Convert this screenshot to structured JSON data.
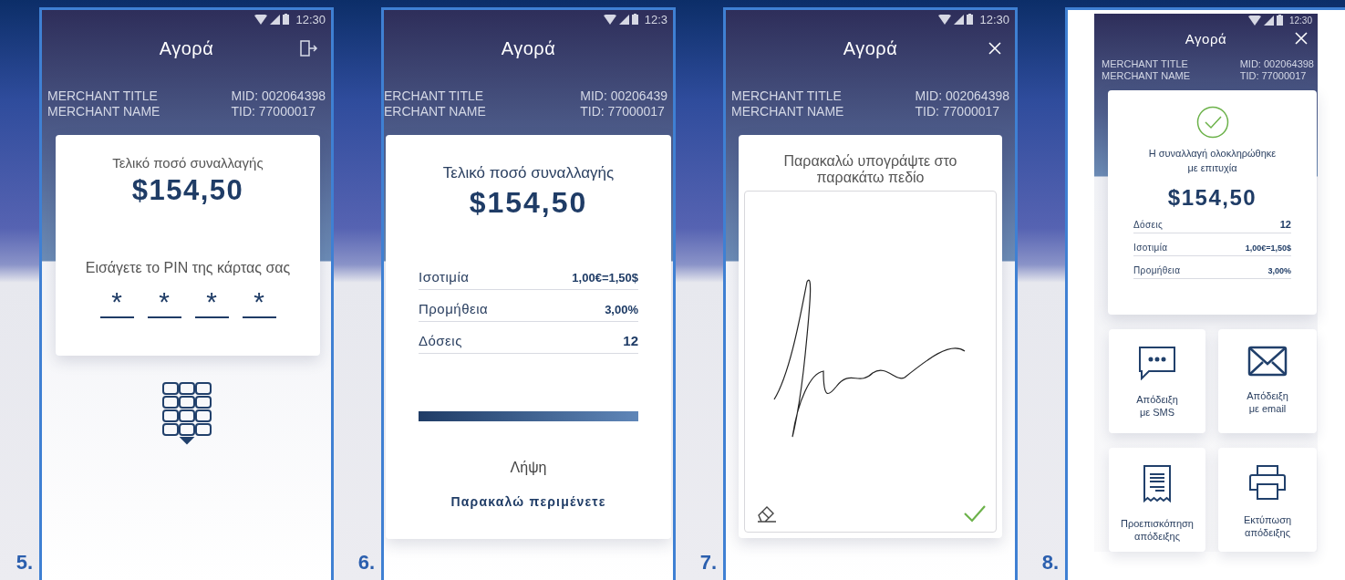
{
  "screens": [
    {
      "kind": "pin",
      "step": "5.",
      "status_time": "12:30",
      "title": "Αγορά",
      "merchant_title": "MERCHANT TITLE",
      "merchant_name": "MERCHANT NAME",
      "mid": "MID: 002064398",
      "tid": "TID: 77000017",
      "amount_label": "Τελικό ποσό συναλλαγής",
      "amount": "$154,50",
      "pin_prompt": "Εισάγετε το PIN της κάρτας σας",
      "pin_digits": [
        "*",
        "*",
        "*",
        "*"
      ]
    },
    {
      "kind": "processing",
      "step": "6.",
      "status_time": "12:3",
      "title": "Αγορά",
      "merchant_title": "ERCHANT TITLE",
      "merchant_name": "ERCHANT NAME",
      "mid": "MID: 00206439",
      "tid": "TID: 77000017",
      "amount_label": "Τελικό ποσό συναλλαγής",
      "amount": "$154,50",
      "details": [
        {
          "label": "Ισοτιμία",
          "value": "1,00€=1,50$"
        },
        {
          "label": "Προμήθεια",
          "value": "3,00%"
        },
        {
          "label": "Δόσεις",
          "value": "12"
        }
      ],
      "progress": {
        "level": 1
      },
      "status": "Λήψη",
      "message": "Παρακαλώ περιμένετε"
    },
    {
      "kind": "signature",
      "step": "7.",
      "status_time": "12:30",
      "title": "Αγορά",
      "merchant_title": "MERCHANT TITLE",
      "merchant_name": "MERCHANT NAME",
      "mid": "MID: 002064398",
      "tid": "TID: 77000017",
      "prompt": "Παρακαλώ υπογράψτε στο παρακάτω πεδίο"
    },
    {
      "kind": "receipt",
      "step": "8.",
      "status_time": "12:30",
      "title": "Αγορά",
      "merchant_title": "MERCHANT TITLE",
      "merchant_name": "MERCHANT NAME",
      "mid": "MID: 002064398",
      "tid": "TID: 77000017",
      "message": "Η συναλλαγή ολοκληρώθηκε με επιτυχία",
      "amount": "$154,50",
      "details": [
        {
          "label": "Δόσεις",
          "value": "12"
        },
        {
          "label": "Ισοτιμία",
          "value": "1,00€=1,50$"
        },
        {
          "label": "Προμήθεια",
          "value": "3,00%"
        }
      ],
      "actions": [
        {
          "lines": [
            "Απόδειξη",
            "με SMS"
          ]
        },
        {
          "lines": [
            "Απόδειξη",
            "με email"
          ]
        },
        {
          "lines": [
            "Προεπισκόπηση",
            "απόδειξης"
          ]
        },
        {
          "lines": [
            "Εκτύπωση",
            "απόδειξης"
          ]
        }
      ]
    }
  ]
}
